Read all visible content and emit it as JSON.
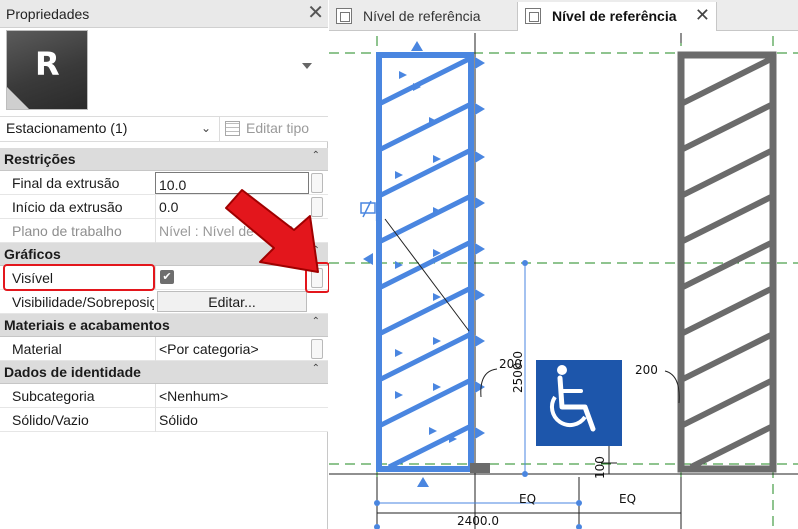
{
  "properties_panel": {
    "title": "Propriedades",
    "close_glyph": "✕",
    "type_thumbnail_letter": "R",
    "instance_selector": "Estacionamento (1)",
    "edit_type_label": "Editar tipo",
    "categories": {
      "restricoes": "Restrições",
      "graficos": "Gráficos",
      "materiais": "Materiais e acabamentos",
      "identidade": "Dados de identidade"
    },
    "rows": {
      "final_label": "Final da extrusão",
      "final_value": "10.0",
      "inicio_label": "Início da extrusão",
      "inicio_value": "0.0",
      "plano_label": "Plano de trabalho",
      "plano_value": "Nível : Nível de referência",
      "visivel_label": "Visível",
      "visivel_checked": "✔",
      "visibilidade_label": "Visibilidade/Sobreposição",
      "visibilidade_button": "Editar...",
      "material_label": "Material",
      "material_value": "<Por categoria>",
      "subcategoria_label": "Subcategoria",
      "subcategoria_value": "<Nenhum>",
      "solido_label": "Sólido/Vazio",
      "solido_value": "Sólido"
    },
    "collapse_glyph": "⌃",
    "dropdown_glyph": "⌄"
  },
  "tabs": [
    {
      "label": "Nível de referência",
      "active": false
    },
    {
      "label": "Nível de referência",
      "active": true,
      "close_glyph": "✕"
    }
  ],
  "drawing": {
    "dim_200_left": "200",
    "dim_200_right": "200",
    "dim_2500": "2500.0",
    "dim_100": "100",
    "eq_left": "EQ",
    "eq_right": "EQ",
    "dim_2400": "2400.0",
    "colors": {
      "selection_blue": "#4a86e0",
      "hatch_gray": "#6b6b6b",
      "ref_green": "#1f8a1f",
      "accessibility_blue": "#1d56ab",
      "highlight_red": "#e3161c"
    }
  }
}
